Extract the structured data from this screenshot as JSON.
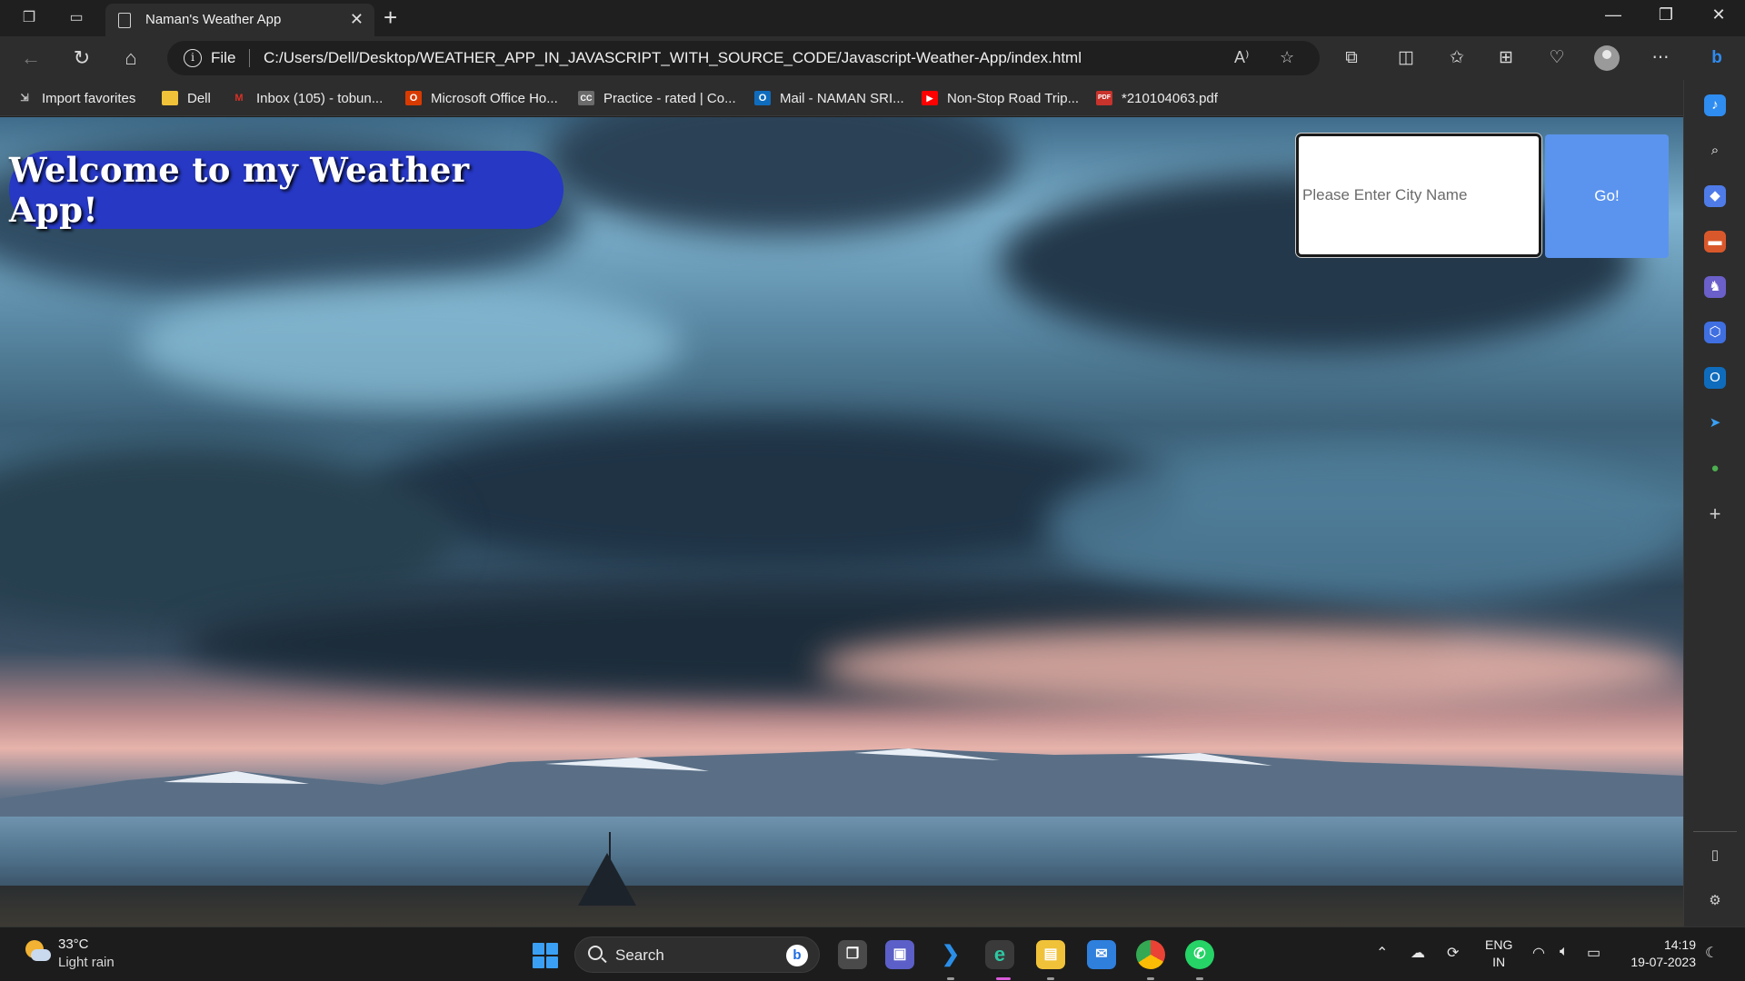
{
  "browser": {
    "tab_title": "Naman's Weather App",
    "tab_close": "✕",
    "new_tab": "+",
    "window_controls": {
      "minimize": "—",
      "restore": "❐",
      "close": "✕"
    },
    "address": {
      "scheme_label": "File",
      "info_glyph": "i",
      "url": "C:/Users/Dell/Desktop/WEATHER_APP_IN_JAVASCRIPT_WITH_SOURCE_CODE/Javascript-Weather-App/index.html",
      "read_aloud_glyph": "A⁾"
    },
    "favorites": [
      {
        "label": "Import favorites",
        "icon": "import-favorites-icon",
        "color": "#cfcfcf",
        "glyph": "⇲"
      },
      {
        "label": "Dell",
        "icon": "folder-icon",
        "color": "#f0c23a",
        "glyph": ""
      },
      {
        "label": "Inbox (105) - tobun...",
        "icon": "gmail-icon",
        "color": "#d93025",
        "glyph": "M"
      },
      {
        "label": "Microsoft Office Ho...",
        "icon": "office-icon",
        "color": "#d83b01",
        "glyph": "O"
      },
      {
        "label": "Practice - rated | Co...",
        "icon": "codechef-icon",
        "color": "#6b6b6b",
        "glyph": "CC"
      },
      {
        "label": "Mail - NAMAN SRI...",
        "icon": "outlook-icon",
        "color": "#0f6cbd",
        "glyph": "O"
      },
      {
        "label": "Non-Stop Road Trip...",
        "icon": "youtube-icon",
        "color": "#ff0000",
        "glyph": "▶"
      },
      {
        "label": "*210104063.pdf",
        "icon": "pdf-icon",
        "color": "#c8332c",
        "glyph": "PDF"
      }
    ]
  },
  "app": {
    "welcome_title": "Welcome to my Weather App!",
    "search": {
      "placeholder": "Please Enter City Name",
      "value": ""
    },
    "go_label": "Go!"
  },
  "taskbar": {
    "weather": {
      "temp": "33°C",
      "condition": "Light rain"
    },
    "search_label": "Search",
    "bing_glyph": "b",
    "language": {
      "line1": "ENG",
      "line2": "IN"
    },
    "time": "14:19",
    "date": "19-07-2023"
  },
  "colors": {
    "welcome_bg": "#2638c4",
    "go_button_bg": "#5b94ee",
    "accent": "#3aa0f5"
  }
}
